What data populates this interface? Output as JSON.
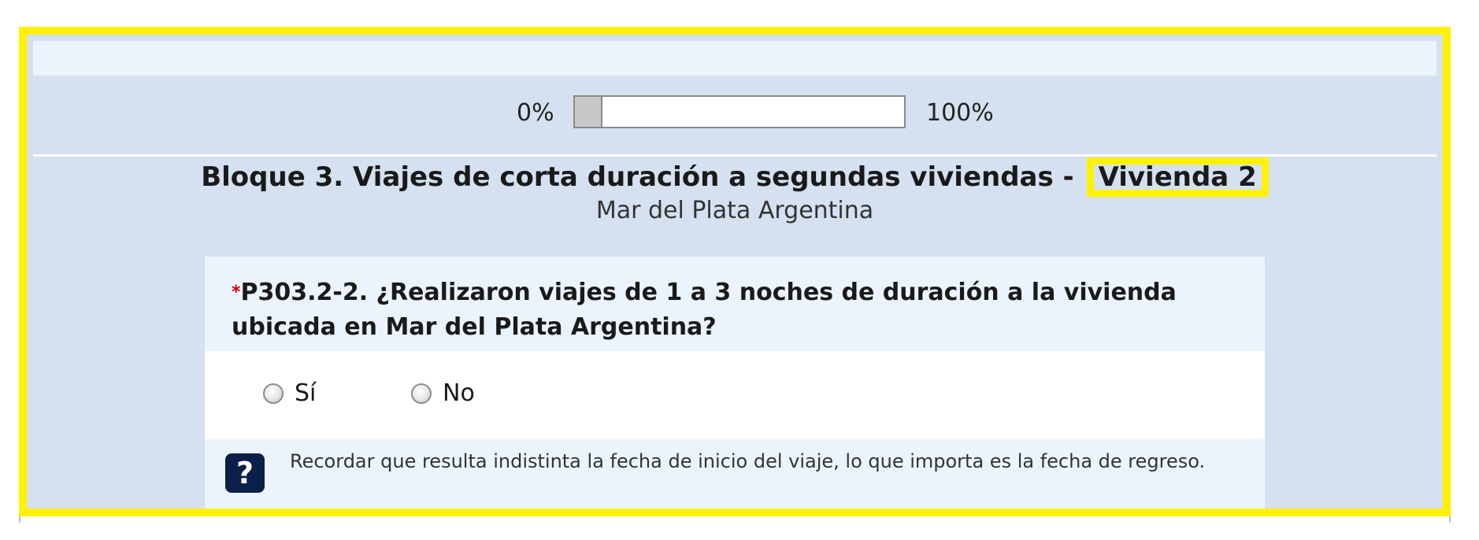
{
  "progress": {
    "min_label": "0%",
    "max_label": "100%",
    "value_fraction": 0.08
  },
  "block": {
    "title": "Bloque 3. Viajes de corta duración a segundas viviendas -",
    "highlight": "Vivienda 2",
    "subtitle": "Mar del Plata Argentina"
  },
  "question": {
    "required_mark": "*",
    "text": "P303.2-2. ¿Realizaron viajes de 1 a 3 noches de duración a la vivienda ubicada en Mar del Plata Argentina?",
    "options": [
      {
        "label": "Sí",
        "selected": false
      },
      {
        "label": "No",
        "selected": false
      }
    ],
    "help_icon_glyph": "?",
    "help_text": "Recordar que resulta indistinta la fecha de inicio del viaje, lo que importa es la fecha de regreso."
  },
  "colors": {
    "highlight": "#fff200",
    "panel_bg": "#d5e1f0",
    "light_bg": "#ebf4fc",
    "help_icon_bg": "#0a1f4a",
    "required": "#e00000"
  }
}
